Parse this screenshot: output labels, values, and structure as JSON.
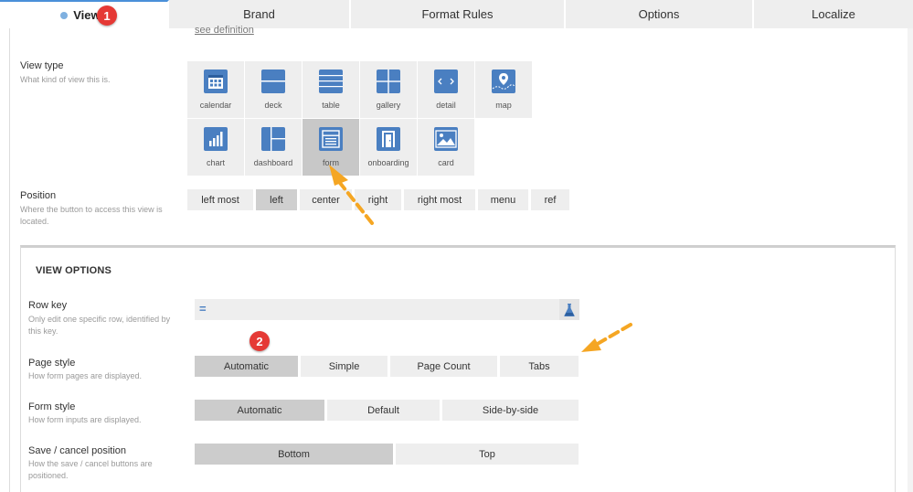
{
  "tabs": [
    {
      "label": "Views",
      "active": true
    },
    {
      "label": "Brand"
    },
    {
      "label": "Format Rules"
    },
    {
      "label": "Options"
    },
    {
      "label": "Localize"
    }
  ],
  "see_definition": "see definition",
  "view_type": {
    "label": "View type",
    "hint": "What kind of view this is.",
    "items": [
      {
        "name": "calendar",
        "icon": "calendar-icon"
      },
      {
        "name": "deck",
        "icon": "deck-icon"
      },
      {
        "name": "table",
        "icon": "table-icon"
      },
      {
        "name": "gallery",
        "icon": "gallery-icon"
      },
      {
        "name": "detail",
        "icon": "detail-icon"
      },
      {
        "name": "map",
        "icon": "map-icon"
      },
      {
        "name": "chart",
        "icon": "chart-icon"
      },
      {
        "name": "dashboard",
        "icon": "dashboard-icon"
      },
      {
        "name": "form",
        "icon": "form-icon",
        "selected": true
      },
      {
        "name": "onboarding",
        "icon": "onboarding-icon"
      },
      {
        "name": "card",
        "icon": "card-icon"
      }
    ]
  },
  "position": {
    "label": "Position",
    "hint": "Where the button to access this view is located.",
    "options": [
      "left most",
      "left",
      "center",
      "right",
      "right most",
      "menu",
      "ref"
    ],
    "selected": "left"
  },
  "view_options": {
    "title": "VIEW OPTIONS",
    "row_key": {
      "label": "Row key",
      "hint": "Only edit one specific row, identified by this key.",
      "value": "",
      "prefix_icon": "equals-icon",
      "suffix_icon": "flask-icon"
    },
    "page_style": {
      "label": "Page style",
      "hint": "How form pages are displayed.",
      "options": [
        "Automatic",
        "Simple",
        "Page Count",
        "Tabs"
      ],
      "selected": "Automatic"
    },
    "form_style": {
      "label": "Form style",
      "hint": "How form inputs are displayed.",
      "options": [
        "Automatic",
        "Default",
        "Side-by-side"
      ],
      "selected": "Automatic"
    },
    "save_cancel": {
      "label": "Save / cancel position",
      "hint": "How the save / cancel buttons are positioned.",
      "options": [
        "Bottom",
        "Top"
      ],
      "selected": "Bottom"
    }
  },
  "annotations": {
    "badge_1": "1",
    "badge_2": "2"
  },
  "colors": {
    "accent": "#4a7fc1",
    "badge": "#e53935",
    "arrow": "#f5a623",
    "selected": "#cccccc"
  }
}
